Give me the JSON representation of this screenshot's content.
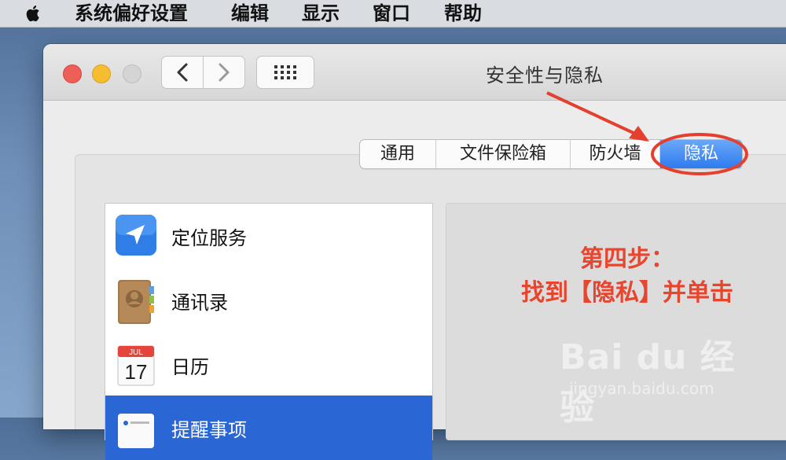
{
  "menubar": {
    "apple_icon": "apple-logo-icon",
    "items": [
      "系统偏好设置",
      "编辑",
      "显示",
      "窗口",
      "帮助"
    ]
  },
  "window": {
    "title": "安全性与隐私",
    "controls": [
      "close",
      "minimize",
      "zoom"
    ],
    "nav": {
      "back_icon": "chevron-left-icon",
      "forward_icon": "chevron-right-icon",
      "grid_icon": "grid-icon"
    }
  },
  "tabs": [
    {
      "label": "通用"
    },
    {
      "label": "文件保险箱"
    },
    {
      "label": "防火墙"
    },
    {
      "label": "隐私",
      "active": true
    }
  ],
  "privacy_list": [
    {
      "label": "定位服务",
      "icon": "location-arrow-icon"
    },
    {
      "label": "通讯录",
      "icon": "contacts-book-icon"
    },
    {
      "label": "日历",
      "icon": "calendar-icon",
      "month": "JUL",
      "day": "17"
    },
    {
      "label": "提醒事项",
      "icon": "reminders-icon",
      "selected": true
    }
  ],
  "annotation": {
    "line1": "第四步：",
    "line2": "找到【隐私】并单击",
    "color": "#e8452f"
  },
  "watermark": {
    "logo_text": "Bai du 经验",
    "url": "jingyan.baidu.com"
  },
  "colors": {
    "accent": "#2f7cf0",
    "selection": "#2b66d5",
    "annotation": "#e4402d"
  }
}
